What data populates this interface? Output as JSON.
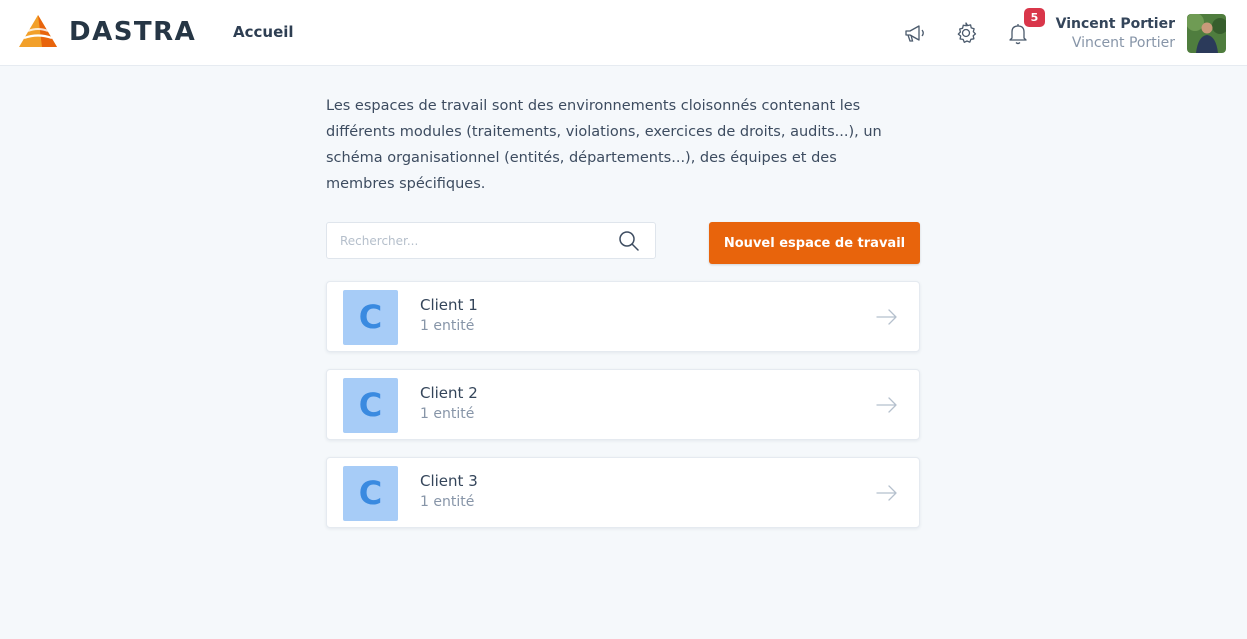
{
  "brand": {
    "name": "DASTRA",
    "accent": "#e8640c"
  },
  "nav": {
    "home_label": "Accueil"
  },
  "header": {
    "icons": [
      "megaphone-icon",
      "gear-icon",
      "bell-icon"
    ],
    "notification_count": "5",
    "user": {
      "name": "Vincent Portier",
      "subtitle": "Vincent Portier"
    }
  },
  "intro": {
    "text": "Les espaces de travail sont des environnements cloisonnés contenant les différents modules (traitements, violations, exercices de droits, audits...), un schéma organisationnel (entités, départements...), des équipes et des membres spécifiques."
  },
  "search": {
    "placeholder": "Rechercher..."
  },
  "actions": {
    "new_workspace_label": "Nouvel espace de travail"
  },
  "workspaces": [
    {
      "initial": "C",
      "name": "Client 1",
      "entities": "1 entité"
    },
    {
      "initial": "C",
      "name": "Client 2",
      "entities": "1 entité"
    },
    {
      "initial": "C",
      "name": "Client 3",
      "entities": "1 entité"
    }
  ]
}
